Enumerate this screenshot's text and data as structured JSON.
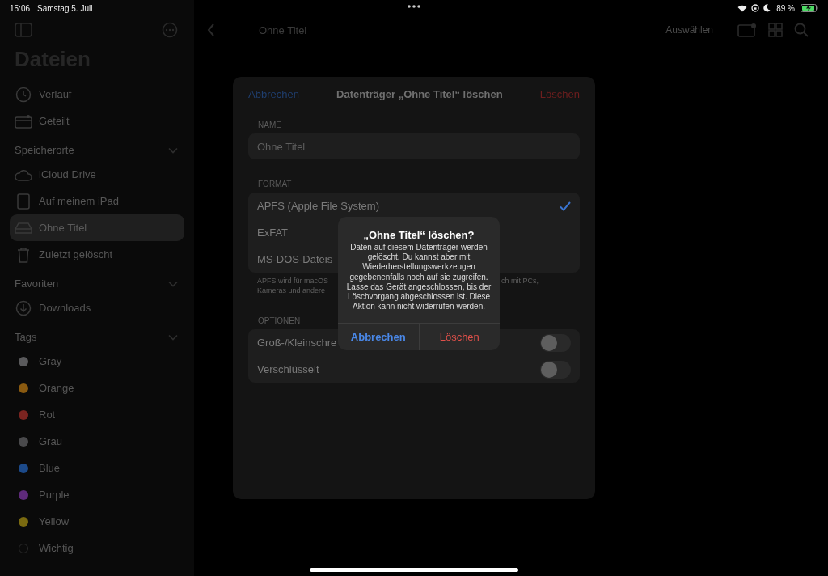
{
  "status_bar": {
    "time": "15:06",
    "date": "Samstag 5. Juli",
    "battery": "89 %"
  },
  "sidebar": {
    "title": "Dateien",
    "sections": [
      {
        "items": [
          {
            "label": "Verlauf",
            "kind": "clock",
            "selected": false
          },
          {
            "label": "Geteilt",
            "kind": "shared",
            "selected": false
          }
        ]
      },
      {
        "header": "Speicherorte",
        "expanded": true,
        "items": [
          {
            "label": "iCloud Drive",
            "kind": "cloud",
            "selected": false
          },
          {
            "label": "Auf meinem iPad",
            "kind": "ipad",
            "selected": false
          },
          {
            "label": "Ohne Titel",
            "kind": "drive",
            "selected": true
          },
          {
            "label": "Zuletzt gelöscht",
            "kind": "trash",
            "selected": false
          }
        ]
      },
      {
        "header": "Favoriten",
        "expanded": true,
        "items": [
          {
            "label": "Downloads",
            "kind": "download",
            "selected": false
          }
        ]
      },
      {
        "header": "Tags",
        "expanded": true,
        "items": [
          {
            "label": "Gray",
            "kind": "tag",
            "color": "#5a5a5c",
            "selected": false
          },
          {
            "label": "Orange",
            "kind": "tag",
            "color": "#8a5a10",
            "selected": false
          },
          {
            "label": "Rot",
            "kind": "tag",
            "color": "#7a2420",
            "selected": false
          },
          {
            "label": "Grau",
            "kind": "tag",
            "color": "#4a4a4c",
            "selected": false
          },
          {
            "label": "Blue",
            "kind": "tag",
            "color": "#1c4a8a",
            "selected": false
          },
          {
            "label": "Purple",
            "kind": "tag",
            "color": "#5e2a7a",
            "selected": false
          },
          {
            "label": "Yellow",
            "kind": "tag",
            "color": "#7a6a10",
            "selected": false
          },
          {
            "label": "Wichtig",
            "kind": "empty-tag",
            "selected": false
          }
        ]
      }
    ]
  },
  "toolbar": {
    "title": "Ohne Titel",
    "select_label": "Auswählen"
  },
  "sheet": {
    "cancel": "Abbrechen",
    "title": "Datenträger „Ohne Titel“ löschen",
    "confirm": "Löschen",
    "name_label": "NAME",
    "name_placeholder": "Ohne Titel",
    "format_label": "FORMAT",
    "formats": [
      {
        "label": "APFS (Apple File System)",
        "selected": true
      },
      {
        "label": "ExFAT",
        "selected": false
      },
      {
        "label": "MS-DOS-Dateis",
        "selected": false
      }
    ],
    "format_note_left": [
      "APFS wird für macOS",
      "Kameras und andere"
    ],
    "format_note_right": "ch mit PCs,",
    "options_label": "OPTIONEN",
    "options": [
      {
        "label": "Groß-/Kleinschre",
        "on": false
      },
      {
        "label": "Verschlüsselt",
        "on": false
      }
    ]
  },
  "alert": {
    "title": "„Ohne Titel“ löschen?",
    "message": "Daten auf diesem Datenträger werden gelöscht. Du kannst aber mit Wiederherstellungswerkzeugen gegebenenfalls noch auf sie zugreifen. Lasse das Gerät angeschlossen, bis der Löschvorgang abgeschlossen ist. Diese Aktion kann nicht widerrufen werden.",
    "buttons": [
      {
        "label": "Abbrechen",
        "kind": "cancel"
      },
      {
        "label": "Löschen",
        "kind": "destructive"
      }
    ]
  }
}
